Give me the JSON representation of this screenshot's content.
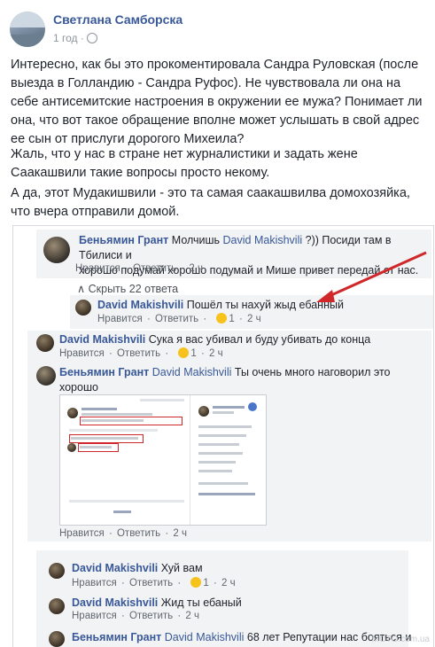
{
  "post": {
    "author": "Светлана Самборска",
    "time": "1 год",
    "dot": "·",
    "paragraphs": [
      "Интересно, как бы это прокоментировала Сандра Руловская (после выезда в Голландию - Сандра Руфос). Не чувствовала ли она на себе антисемитские настроения в окружении ее мужа? Понимает ли она, что вот такое обращение вполне может услышать в свой адрес ее сын от прислуги дорогого Михеила?",
      "Жаль, что у нас в стране нет журналистики и задать жене Саакашвили такие вопросы просто некому.",
      "А да, этот Мудакишвили - это та самая саакашвилва домохозяйка, что вчера отправили домой."
    ]
  },
  "comments": {
    "c1": {
      "name": "Беньямин Грант",
      "mention": "David Makishvili",
      "text1": " Молчишь ",
      "text2": " ?)) Посиди там в Тбилиси и",
      "text3": "хорошо подумай хорошо подумай и Мише привет передай от нас.",
      "like": "Нравится",
      "reply": "Ответить",
      "time": "2 ч"
    },
    "toggle": "Скрыть 22 ответа",
    "c2": {
      "name": "David Makishvili",
      "text": " Пошёл ты нахуй жыд ебанный",
      "like": "Нравится",
      "reply": "Ответить",
      "count": "1",
      "time": "2 ч"
    },
    "c3": {
      "name": "David Makishvili",
      "text": " Сука я вас убивал и буду убивать до конца",
      "like": "Нравится",
      "reply": "Ответить",
      "count": "1",
      "time": "2 ч"
    },
    "c4": {
      "name": "Беньямин Грант",
      "mention": "David Makishvili",
      "text1": " Ты очень много наговорил это",
      "text2": "хорошо",
      "like": "Нравится",
      "reply": "Ответить",
      "time": "2 ч"
    },
    "c5": {
      "name": "David Makishvili",
      "text": " Хуй вам",
      "like": "Нравится",
      "reply": "Ответить",
      "count": "1",
      "time": "2 ч"
    },
    "c6": {
      "name": "David Makishvili",
      "text": " Жид ты ебаный",
      "like": "Нравится",
      "reply": "Ответить",
      "time": "2 ч"
    },
    "c7": {
      "name": "Беньямин Грант",
      "mention": "David Makishvili",
      "text": " 68 лет Репутации нас бояться и"
    },
    "sep": " · "
  },
  "watermark": "MOTO.com.ua",
  "colors": {
    "link": "#385898",
    "arrow": "#d0282a",
    "bubble": "#f2f3f5"
  }
}
